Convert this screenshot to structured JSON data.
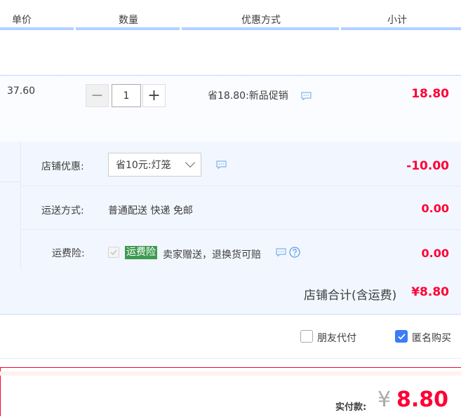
{
  "header": {
    "col_price": "单价",
    "col_qty": "数量",
    "col_promo": "优惠方式",
    "col_subtotal": "小计"
  },
  "item": {
    "unit_price": "37.60",
    "quantity": "1",
    "minus": "−",
    "plus": "+",
    "promo_text": "省18.80:新品促销",
    "subtotal": "18.80"
  },
  "store": {
    "discount_label": "店铺优惠:",
    "discount_selected": "省10元:灯笼",
    "discount_amount": "-10.00",
    "shipping_label": "运送方式:",
    "shipping_value": "普通配送 快递 免邮",
    "shipping_amount": "0.00",
    "insurance_label": "运费险:",
    "insurance_badge": "运费险",
    "insurance_text": "卖家赠送，退换货可赔",
    "insurance_amount": "0.00",
    "total_label": "店铺合计(含运费)",
    "total_amount": "¥8.80"
  },
  "options": {
    "friend_pay": "朋友代付",
    "anonymous": "匿名购买",
    "friend_pay_checked": false,
    "anonymous_checked": true
  },
  "pay": {
    "label": "实付款:",
    "currency": "¥",
    "amount": "8.80"
  },
  "colors": {
    "accent_red": "#ff0036",
    "header_underline": "#b2d1ff",
    "badge_green": "#3e9b4f",
    "checkbox_blue": "#3c7cf5"
  }
}
